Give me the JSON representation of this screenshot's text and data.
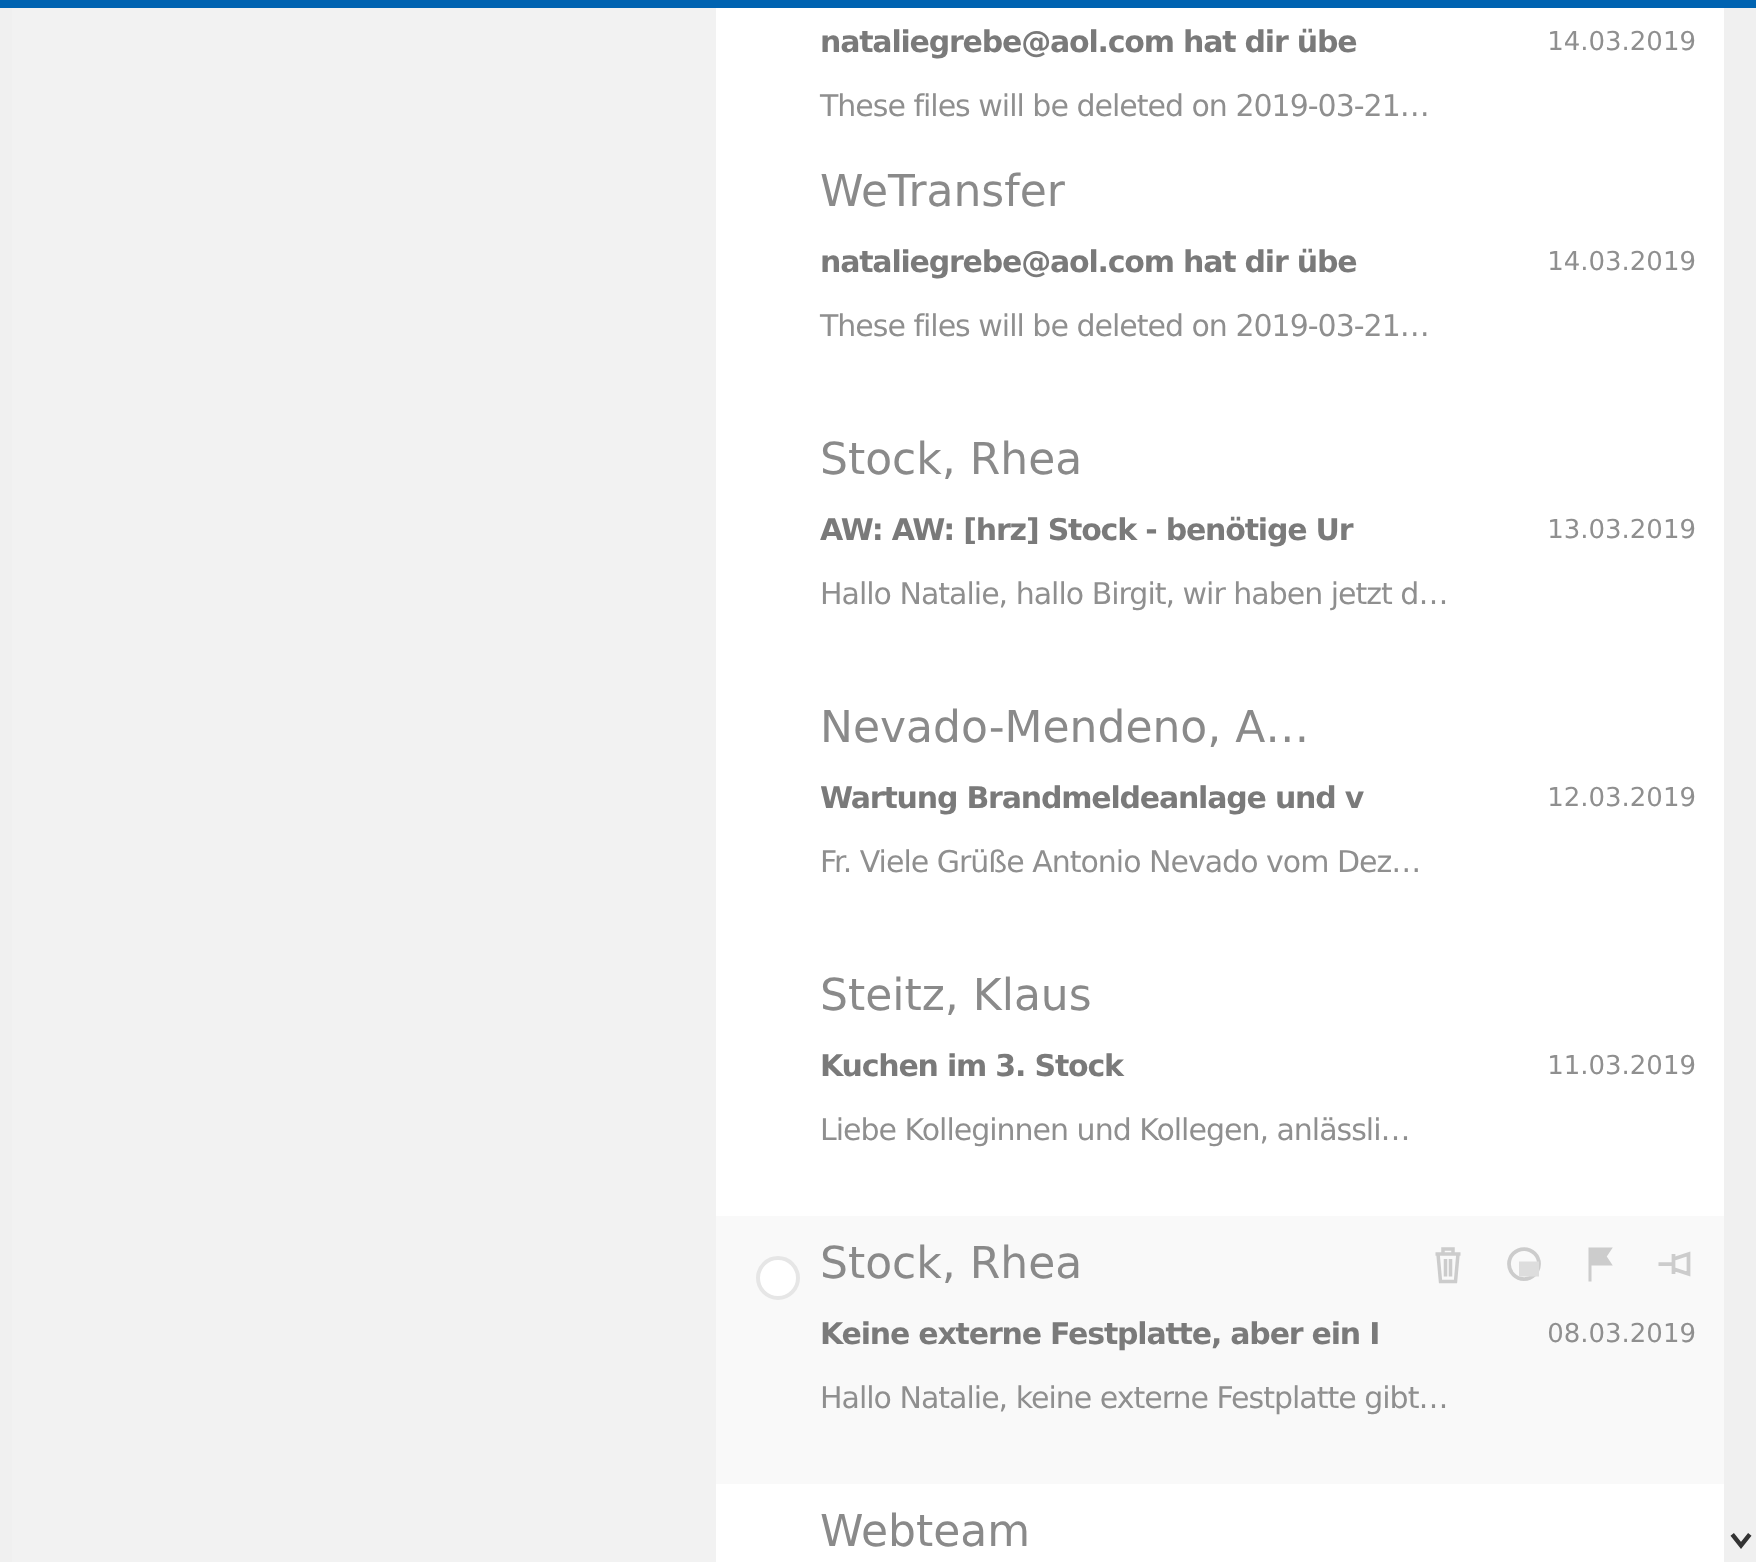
{
  "messages": [
    {
      "subject": "nataliegrebe@aol.com hat dir übe",
      "date": "14.03.2019",
      "preview": "These files will be deleted on 2019-03-21…",
      "hovered": false
    },
    {
      "sender": "WeTransfer",
      "subject": "nataliegrebe@aol.com hat dir übe",
      "date": "14.03.2019",
      "preview": "These files will be deleted on 2019-03-21…",
      "hovered": false
    },
    {
      "sender": "Stock, Rhea",
      "subject": "AW: AW: [hrz] Stock - benötige Ur",
      "date": "13.03.2019",
      "preview": "Hallo Natalie, hallo Birgit, wir haben jetzt d…",
      "hovered": false
    },
    {
      "sender": "Nevado-Mendeno, A…",
      "subject": "Wartung Brandmeldeanlage und v",
      "date": "12.03.2019",
      "preview": "Fr. Viele Grüße Antonio Nevado vom Dez…",
      "hovered": false
    },
    {
      "sender": "Steitz, Klaus",
      "subject": "Kuchen im 3. Stock",
      "date": "11.03.2019",
      "preview": "Liebe Kolleginnen und Kollegen, anlässli…",
      "hovered": false
    },
    {
      "sender": "Stock, Rhea",
      "subject": "Keine externe Festplatte, aber ein I",
      "date": "08.03.2019",
      "preview": "Hallo Natalie, keine externe Festplatte gibt…",
      "hovered": true
    },
    {
      "sender": "Webteam",
      "hovered": false
    }
  ]
}
